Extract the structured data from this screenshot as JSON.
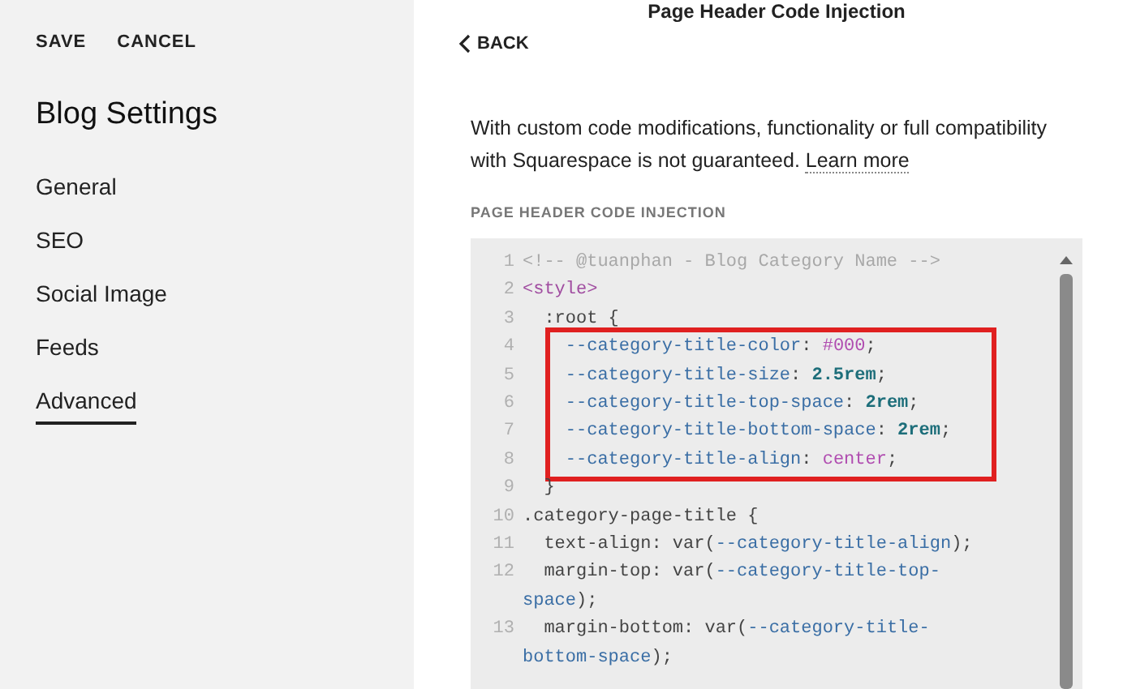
{
  "sidebar": {
    "actions": [
      "SAVE",
      "CANCEL"
    ],
    "title": "Blog Settings",
    "items": [
      {
        "label": "General",
        "selected": false
      },
      {
        "label": "SEO",
        "selected": false
      },
      {
        "label": "Social Image",
        "selected": false
      },
      {
        "label": "Feeds",
        "selected": false
      },
      {
        "label": "Advanced",
        "selected": true
      }
    ]
  },
  "panel": {
    "title": "Page Header Code Injection",
    "back": "BACK",
    "notice": "With custom code modifications, functionality or full compatibility with Squarespace is not guaranteed.",
    "notice_link": "Learn more",
    "field_label": "PAGE HEADER CODE INJECTION",
    "code_lines": [
      {
        "number": "1",
        "highlighted": false,
        "segments": [
          {
            "kind": "comment",
            "text": "<!-- @tuanphan - Blog Category Name -->"
          }
        ]
      },
      {
        "number": "2",
        "highlighted": false,
        "segments": [
          {
            "kind": "tag",
            "text": "<style>"
          }
        ]
      },
      {
        "number": "3",
        "highlighted": false,
        "segments": [
          {
            "kind": "plain",
            "text": "  :root {"
          }
        ]
      },
      {
        "number": "4",
        "highlighted": true,
        "segments": [
          {
            "kind": "var",
            "text": "    --category-title-color"
          },
          {
            "kind": "plain",
            "text": ": "
          },
          {
            "kind": "color",
            "text": "#000"
          },
          {
            "kind": "plain",
            "text": ";"
          }
        ]
      },
      {
        "number": "5",
        "highlighted": true,
        "segments": [
          {
            "kind": "var",
            "text": "    --category-title-size"
          },
          {
            "kind": "plain",
            "text": ": "
          },
          {
            "kind": "number",
            "text": "2.5rem"
          },
          {
            "kind": "plain",
            "text": ";"
          }
        ]
      },
      {
        "number": "6",
        "highlighted": true,
        "segments": [
          {
            "kind": "var",
            "text": "    --category-title-top-space"
          },
          {
            "kind": "plain",
            "text": ": "
          },
          {
            "kind": "number",
            "text": "2rem"
          },
          {
            "kind": "plain",
            "text": ";"
          }
        ]
      },
      {
        "number": "7",
        "highlighted": true,
        "segments": [
          {
            "kind": "var",
            "text": "    --category-title-bottom-space"
          },
          {
            "kind": "plain",
            "text": ": "
          },
          {
            "kind": "number",
            "text": "2rem"
          },
          {
            "kind": "plain",
            "text": ";"
          }
        ]
      },
      {
        "number": "8",
        "highlighted": true,
        "segments": [
          {
            "kind": "var",
            "text": "    --category-title-align"
          },
          {
            "kind": "plain",
            "text": ": "
          },
          {
            "kind": "color",
            "text": "center"
          },
          {
            "kind": "plain",
            "text": ";"
          }
        ]
      },
      {
        "number": "9",
        "highlighted": false,
        "segments": [
          {
            "kind": "plain",
            "text": "  }"
          }
        ]
      },
      {
        "number": "10",
        "highlighted": false,
        "segments": [
          {
            "kind": "plain",
            "text": ".category-page-title {"
          }
        ]
      },
      {
        "number": "11",
        "highlighted": false,
        "segments": [
          {
            "kind": "plain",
            "text": "  text-align: var("
          },
          {
            "kind": "var",
            "text": "--category-title-align"
          },
          {
            "kind": "plain",
            "text": ");"
          }
        ]
      },
      {
        "number": "12",
        "highlighted": false,
        "segments": [
          {
            "kind": "plain",
            "text": "  margin-top: var("
          },
          {
            "kind": "var",
            "text": "--category-title-top-space"
          },
          {
            "kind": "plain",
            "text": ");"
          }
        ]
      },
      {
        "number": "13",
        "highlighted": false,
        "segments": [
          {
            "kind": "plain",
            "text": "  margin-bottom: var("
          },
          {
            "kind": "var",
            "text": "--category-title-bottom-space"
          },
          {
            "kind": "plain",
            "text": ");"
          }
        ]
      }
    ]
  }
}
